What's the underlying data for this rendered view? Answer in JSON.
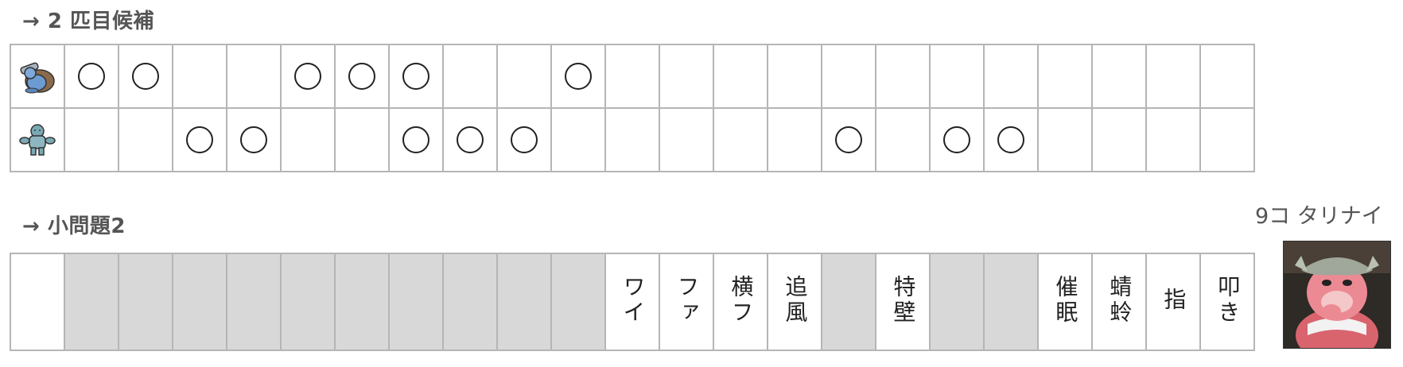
{
  "section1": {
    "heading": "→ 2 匹目候補",
    "rows": [
      {
        "icon": "blastoise-sprite-icon",
        "marks": [
          true,
          true,
          false,
          false,
          true,
          true,
          true,
          false,
          false,
          true,
          false,
          false,
          false,
          false,
          false,
          false,
          false,
          false,
          false,
          false,
          false,
          false
        ]
      },
      {
        "icon": "machop-sprite-icon",
        "marks": [
          false,
          false,
          true,
          true,
          false,
          false,
          true,
          true,
          true,
          false,
          false,
          false,
          false,
          false,
          true,
          false,
          true,
          true,
          false,
          false,
          false,
          false
        ]
      }
    ]
  },
  "section2": {
    "heading": "→ 小問題2",
    "cells": [
      {
        "text": "",
        "filled": false
      },
      {
        "text": "",
        "filled": true
      },
      {
        "text": "",
        "filled": true
      },
      {
        "text": "",
        "filled": true
      },
      {
        "text": "",
        "filled": true
      },
      {
        "text": "",
        "filled": true
      },
      {
        "text": "",
        "filled": true
      },
      {
        "text": "",
        "filled": true
      },
      {
        "text": "",
        "filled": true
      },
      {
        "text": "",
        "filled": true
      },
      {
        "text": "",
        "filled": true
      },
      {
        "text": "ワイ",
        "filled": false
      },
      {
        "text": "ファ",
        "filled": false
      },
      {
        "text": "横フ",
        "filled": false
      },
      {
        "text": "追風",
        "filled": false
      },
      {
        "text": "",
        "filled": true
      },
      {
        "text": "特壁",
        "filled": false
      },
      {
        "text": "",
        "filled": true
      },
      {
        "text": "",
        "filled": true
      },
      {
        "text": "催眠",
        "filled": false
      },
      {
        "text": "蜻蛉",
        "filled": false
      },
      {
        "text": "指",
        "filled": false
      },
      {
        "text": "叩き",
        "filled": false
      }
    ]
  },
  "note": "9コ タリナイ",
  "avatar": {
    "icon": "slowbro-portrait-icon"
  }
}
